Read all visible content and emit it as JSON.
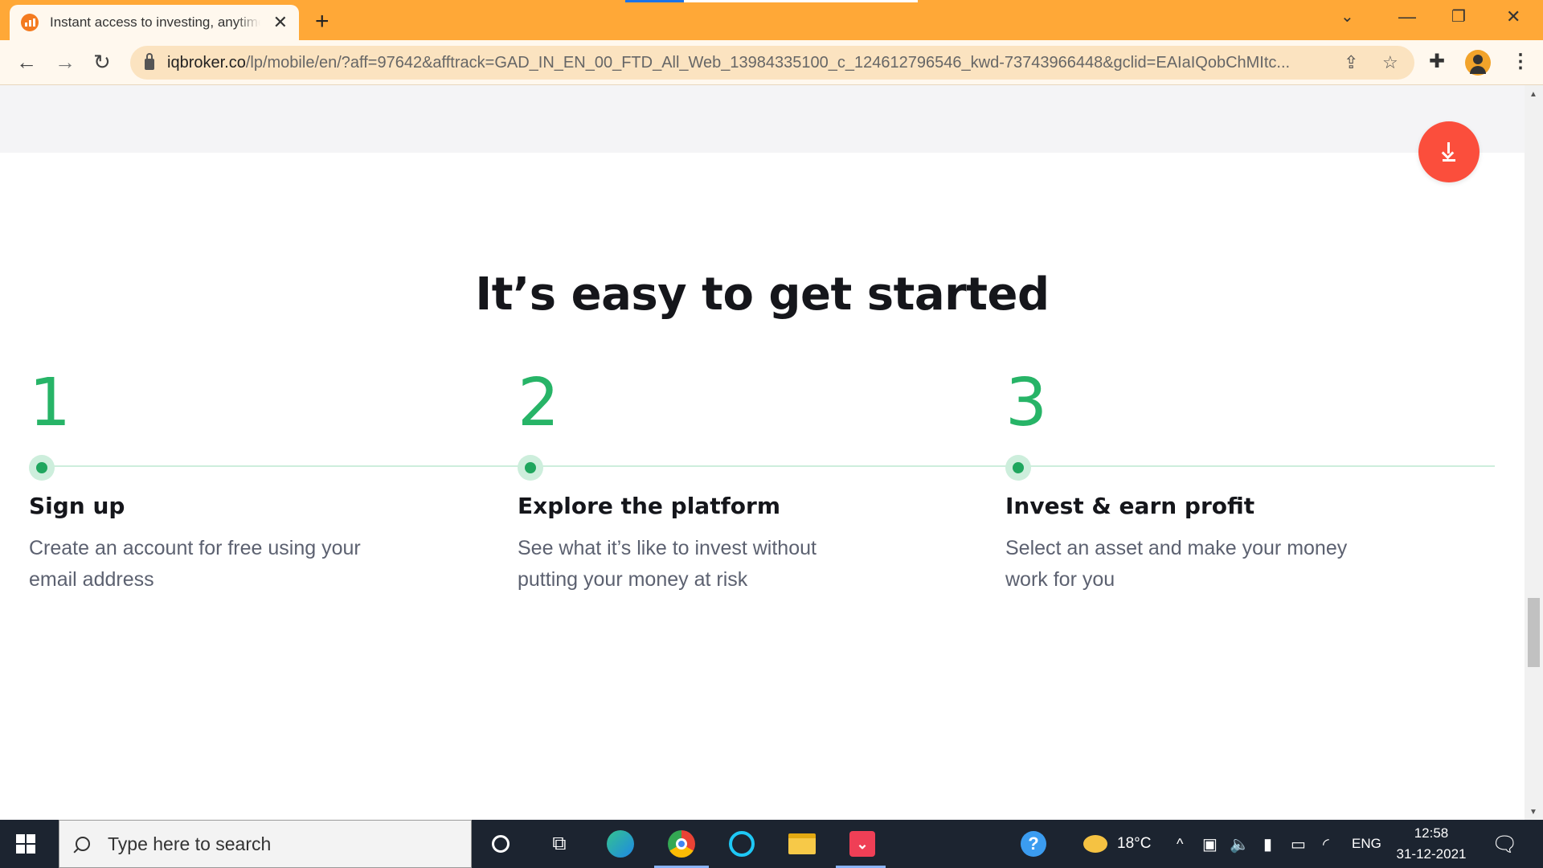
{
  "browser": {
    "tab_title": "Instant access to investing, anytime",
    "new_tab_symbol": "+",
    "url_domain": "iqbroker.co",
    "url_path": "/lp/mobile/en/?aff=97642&afftrack=GAD_IN_EN_00_FTD_All_Web_13984335100_c_124612796546_kwd-73743966448&gclid=EAIaIQobChMItc...",
    "accent_color": "#ffa837"
  },
  "page": {
    "heading": "It’s easy to get started",
    "accent_green": "#27b467",
    "fab_color": "#fb4e3c",
    "steps": [
      {
        "number": "1",
        "title": "Sign up",
        "desc": "Create an account for free using your email address"
      },
      {
        "number": "2",
        "title": "Explore the platform",
        "desc": "See what it’s like to invest without putting your money at risk"
      },
      {
        "number": "3",
        "title": "Invest & earn profit",
        "desc": "Select an asset and make your money work for you"
      }
    ]
  },
  "taskbar": {
    "search_placeholder": "Type here to search",
    "temperature": "18°C",
    "language": "ENG",
    "time": "12:58",
    "date": "31-12-2021",
    "apps": [
      "cortana-icon",
      "task-view-icon",
      "edge-icon",
      "chrome-icon",
      "alexa-icon",
      "file-explorer-icon",
      "pocket-icon"
    ]
  }
}
